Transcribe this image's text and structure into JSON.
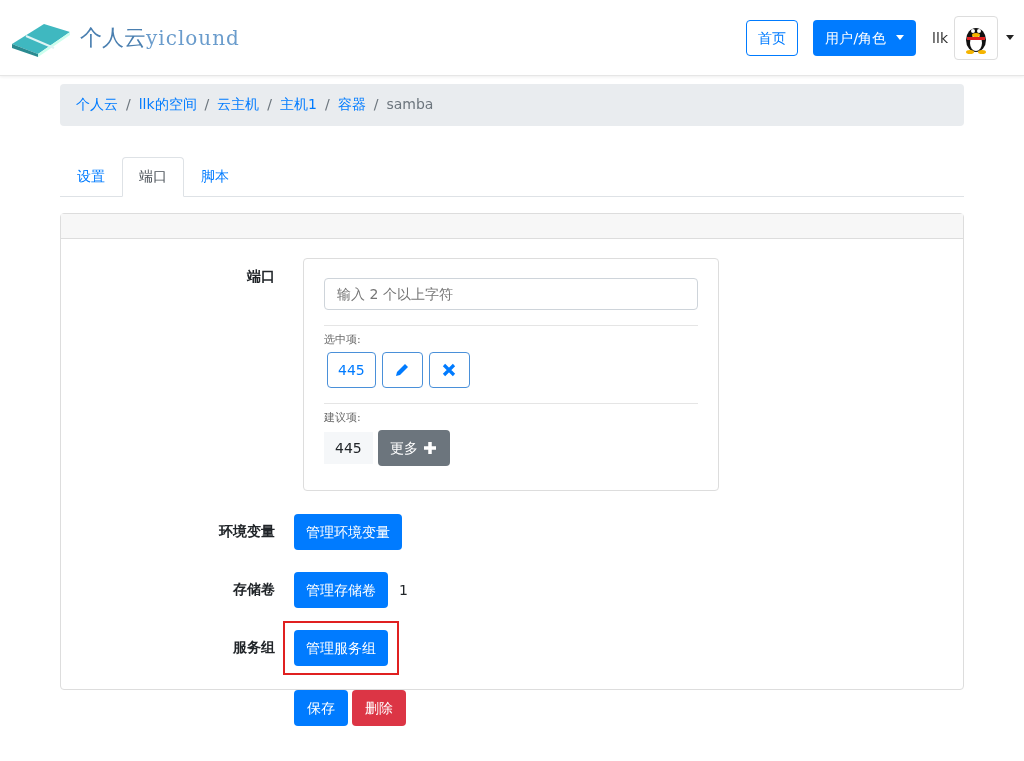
{
  "header": {
    "logo_text": "个人云",
    "logo_latin": "yiclound",
    "home_button": "首页",
    "user_menu": "用户/角色",
    "username": "llk"
  },
  "breadcrumb_separator": "/",
  "breadcrumb": [
    "个人云",
    "llk的空间",
    "云主机",
    "主机1",
    "容器",
    "samba"
  ],
  "tabs": [
    {
      "label": "设置",
      "selected": false
    },
    {
      "label": "端口",
      "selected": true
    },
    {
      "label": "脚本",
      "selected": false
    }
  ],
  "ports": {
    "label": "端口",
    "placeholder": "输入 2 个以上字符",
    "selected_label": "选中项:",
    "selected_items": [
      "445"
    ],
    "suggest_label": "建议项:",
    "suggest_items": [
      "445"
    ],
    "more_button": "更多"
  },
  "rows": [
    {
      "label": "环境变量",
      "button": "管理环境变量",
      "highlighted": false
    },
    {
      "label": "存储卷",
      "button": "管理存储卷",
      "note": "1",
      "highlighted": false
    },
    {
      "label": "服务组",
      "button": "管理服务组",
      "highlighted": true
    }
  ],
  "actions": [
    {
      "label": "保存",
      "kind": "primary"
    },
    {
      "label": "删除",
      "kind": "danger"
    }
  ]
}
